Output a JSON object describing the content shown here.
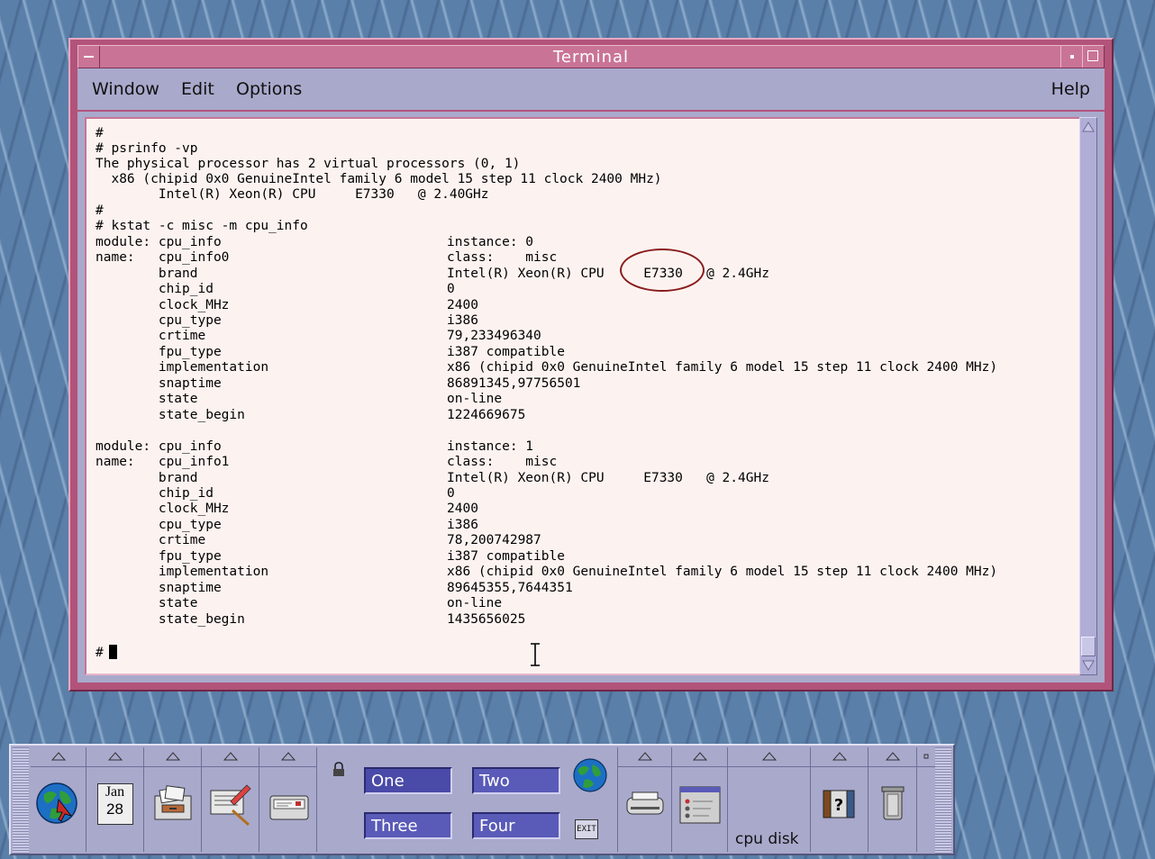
{
  "window": {
    "title": "Terminal"
  },
  "menubar": {
    "window": "Window",
    "edit": "Edit",
    "options": "Options",
    "help": "Help"
  },
  "terminal": {
    "lines": [
      "#",
      "# psrinfo -vp",
      "The physical processor has 2 virtual processors (0, 1)",
      "  x86 (chipid 0x0 GenuineIntel family 6 model 15 step 11 clock 2400 MHz)",
      "        Intel(R) Xeon(R) CPU     E7330   @ 2.40GHz",
      "#",
      "# kstat -c misc -m cpu_info"
    ],
    "blocks": [
      {
        "rows": [
          {
            "label": "module: cpu_info",
            "value": "instance: 0"
          },
          {
            "label": "name:   cpu_info0",
            "value": "class:    misc"
          },
          {
            "label": "        brand",
            "value": "Intel(R) Xeon(R) CPU     E7330   @ 2.4GHz"
          },
          {
            "label": "        chip_id",
            "value": "0"
          },
          {
            "label": "        clock_MHz",
            "value": "2400"
          },
          {
            "label": "        cpu_type",
            "value": "i386"
          },
          {
            "label": "        crtime",
            "value": "79,233496340"
          },
          {
            "label": "        fpu_type",
            "value": "i387 compatible"
          },
          {
            "label": "        implementation",
            "value": "x86 (chipid 0x0 GenuineIntel family 6 model 15 step 11 clock 2400 MHz)"
          },
          {
            "label": "        snaptime",
            "value": "86891345,97756501"
          },
          {
            "label": "        state",
            "value": "on-line"
          },
          {
            "label": "        state_begin",
            "value": "1224669675"
          }
        ]
      },
      {
        "rows": [
          {
            "label": "module: cpu_info",
            "value": "instance: 1"
          },
          {
            "label": "name:   cpu_info1",
            "value": "class:    misc"
          },
          {
            "label": "        brand",
            "value": "Intel(R) Xeon(R) CPU     E7330   @ 2.4GHz"
          },
          {
            "label": "        chip_id",
            "value": "0"
          },
          {
            "label": "        clock_MHz",
            "value": "2400"
          },
          {
            "label": "        cpu_type",
            "value": "i386"
          },
          {
            "label": "        crtime",
            "value": "78,200742987"
          },
          {
            "label": "        fpu_type",
            "value": "i387 compatible"
          },
          {
            "label": "        implementation",
            "value": "x86 (chipid 0x0 GenuineIntel family 6 model 15 step 11 clock 2400 MHz)"
          },
          {
            "label": "        snaptime",
            "value": "89645355,7644351"
          },
          {
            "label": "        state",
            "value": "on-line"
          },
          {
            "label": "        state_begin",
            "value": "1435656025"
          }
        ]
      }
    ],
    "prompt": "#"
  },
  "panel": {
    "calendar_month": "Jan",
    "calendar_day": "28",
    "workspaces": [
      "One",
      "Two",
      "Three",
      "Four"
    ],
    "exit_label": "EXIT",
    "cpu_disk_label": "cpu disk"
  },
  "colors": {
    "window_frame": "#b2537a",
    "terminal_bg": "#fcf3f0",
    "annotation_circle": "#8a1c1c",
    "workspace_button": "#5a5ab8"
  }
}
